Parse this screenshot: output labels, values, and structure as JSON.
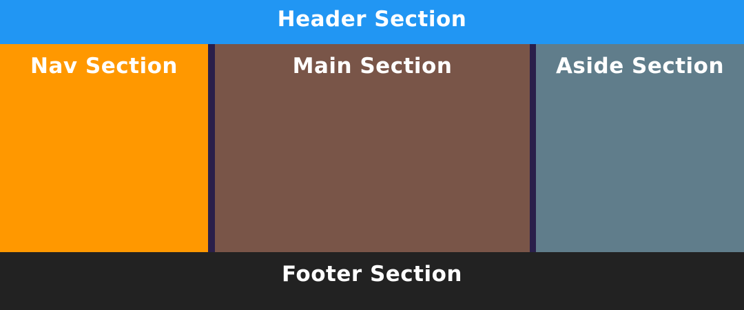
{
  "header": {
    "label": "Header Section",
    "color": "#2196f3"
  },
  "nav": {
    "label": "Nav Section",
    "color": "#ff9800"
  },
  "main": {
    "label": "Main Section",
    "color": "#795548"
  },
  "aside": {
    "label": "Aside Section",
    "color": "#607d8b"
  },
  "footer": {
    "label": "Footer Section",
    "color": "#222222"
  },
  "gutter_color": "#2a1f4a"
}
